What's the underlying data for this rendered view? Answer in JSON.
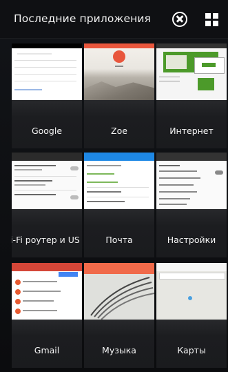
{
  "header": {
    "title": "Последние приложения",
    "close_icon": "close-circle-icon",
    "grid_icon": "grid-view-icon"
  },
  "apps": [
    {
      "label": "Google",
      "accent": "#4285f4"
    },
    {
      "label": "Zoe",
      "accent": "#e8563c"
    },
    {
      "label": "Интернет",
      "accent": "#4c9a2a"
    },
    {
      "label": "Wi-Fi роутер и US",
      "accent": "#888888"
    },
    {
      "label": "Почта",
      "accent": "#1e88e5"
    },
    {
      "label": "Настройки",
      "accent": "#606060"
    },
    {
      "label": "Gmail",
      "accent": "#e85b31"
    },
    {
      "label": "Музыка",
      "accent": "#f06a4a"
    },
    {
      "label": "Карты",
      "accent": "#4aa0e0"
    }
  ]
}
